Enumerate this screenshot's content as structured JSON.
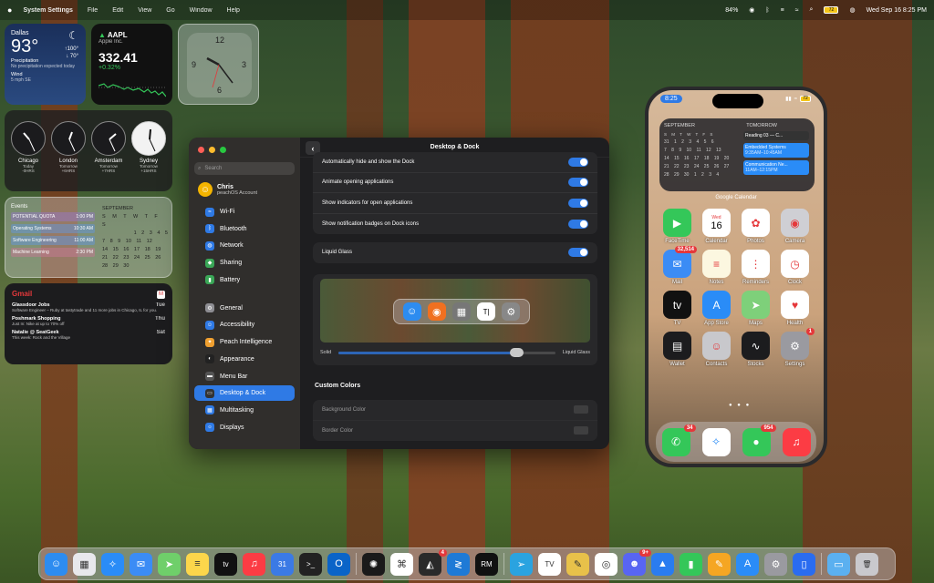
{
  "menubar": {
    "app": "System Settings",
    "items": [
      "File",
      "Edit",
      "View",
      "Go",
      "Window",
      "Help"
    ],
    "battery": "72",
    "datetime": "Wed Sep 16  8:25 PM",
    "percent": "84%"
  },
  "weather": {
    "city": "Dallas",
    "temp": "93°",
    "high": "↑100°",
    "low": "↓ 70°",
    "line1": "Precipitation",
    "line2": "No precipitation expected today",
    "line3": "Wind",
    "line4": "5 mph SE"
  },
  "stock": {
    "ticker": "AAPL",
    "company": "Apple Inc.",
    "price": "332.41",
    "change": "+0.32%"
  },
  "analog": {
    "n12": "12",
    "n3": "3",
    "n6": "6",
    "n9": "9"
  },
  "worldclocks": [
    {
      "city": "Chicago",
      "day": "Today",
      "off": "-0HRS"
    },
    {
      "city": "London",
      "day": "Tomorrow",
      "off": "+6HRS"
    },
    {
      "city": "Amsterdam",
      "day": "Tomorrow",
      "off": "+7HRS"
    },
    {
      "city": "Sydney",
      "day": "Tomorrow",
      "off": "+15HRS"
    }
  ],
  "events": {
    "title": "Events",
    "list": [
      {
        "name": "POTENTIAL QUOTA",
        "time": "1:00 PM"
      },
      {
        "name": "Operating Systems",
        "time": "10:30 AM"
      },
      {
        "name": "Software Engineering",
        "time": "11:00 AM"
      },
      {
        "name": "Machine Learning",
        "time": "2:30 PM"
      }
    ],
    "month": "SEPTEMBER",
    "days": "S M T W T F S",
    "weeks": [
      "1 2 3 4 5",
      "7 8 9 10 11 12",
      "14 15 16 17 18 19",
      "21 22 23 24 25 26",
      "28 29 30"
    ]
  },
  "gmail": {
    "title": "Gmail",
    "mails": [
      {
        "from": "Glassdoor Jobs",
        "date": "Tue",
        "body": "Software Engineer – Ruby at tastytrade and 11 more jobs in Chicago, IL for you."
      },
      {
        "from": "Poshmark Shopping",
        "date": "Thu",
        "body": "Just In: Nike at up to 70% off"
      },
      {
        "from": "Natalie @ SeatGeek",
        "date": "Sat",
        "body": "This week: Rock and the Village"
      }
    ]
  },
  "settings": {
    "title": "Desktop & Dock",
    "search": "Search",
    "user": "Chris",
    "account": "peachOS Account",
    "sidebar": [
      {
        "label": "Wi-Fi",
        "color": "#2f7ae5",
        "icon": "wifi-icon",
        "glyph": "≈"
      },
      {
        "label": "Bluetooth",
        "color": "#2f7ae5",
        "icon": "bluetooth-icon",
        "glyph": "ᛒ"
      },
      {
        "label": "Network",
        "color": "#2f7ae5",
        "icon": "globe-icon",
        "glyph": "◍"
      },
      {
        "label": "Sharing",
        "color": "#3aa757",
        "icon": "sharing-icon",
        "glyph": "◆"
      },
      {
        "label": "Battery",
        "color": "#3aa757",
        "icon": "battery-icon",
        "glyph": "▮"
      },
      {
        "label": "General",
        "color": "#8e8e93",
        "icon": "gear-icon",
        "glyph": "⚙"
      },
      {
        "label": "Accessibility",
        "color": "#2f7ae5",
        "icon": "accessibility-icon",
        "glyph": "☺"
      },
      {
        "label": "Peach Intelligence",
        "color": "#f0a030",
        "icon": "sparkle-icon",
        "glyph": "✦"
      },
      {
        "label": "Appearance",
        "color": "#222",
        "icon": "appearance-icon",
        "glyph": "◐"
      },
      {
        "label": "Menu Bar",
        "color": "#555",
        "icon": "menubar-icon",
        "glyph": "▬"
      },
      {
        "label": "Desktop & Dock",
        "color": "#333",
        "icon": "dock-icon",
        "glyph": "▭"
      },
      {
        "label": "Multitasking",
        "color": "#2f7ae5",
        "icon": "multitasking-icon",
        "glyph": "▦"
      },
      {
        "label": "Displays",
        "color": "#2f7ae5",
        "icon": "display-icon",
        "glyph": "☼"
      }
    ],
    "rows": [
      "Automatically hide and show the Dock",
      "Animate opening applications",
      "Show indicators for open applications",
      "Show notification badges on Dock icons"
    ],
    "liquid": "Liquid Glass",
    "solid": "Solid",
    "liquid_end": "Liquid Glass",
    "slider": 0.82,
    "custom": "Custom Colors",
    "bg": "Background Color",
    "border": "Border Color"
  },
  "phone": {
    "time": "8:25",
    "battery": "72",
    "cal": {
      "month": "SEPTEMBER",
      "tomorrow": "TOMORROW",
      "days": "S M T W T F S",
      "weeks": [
        "31 1 2 3 4 5 6",
        "7 8 9 10 11 12 13",
        "14 15 16 17 18 19 20",
        "21 22 23 24 25 26 27",
        "28 29 30 1 2 3 4"
      ],
      "ev1": "Reading 03 — C...",
      "ev2": "Embedded Systems",
      "ev2t": "9:35AM–10:45AM",
      "ev3": "Communication Ne...",
      "ev3t": "11AM–12:15PM",
      "label": "Google Calendar"
    },
    "apps": [
      {
        "label": "FaceTime",
        "color": "#34c759",
        "glyph": "▶"
      },
      {
        "label": "Calendar",
        "color": "#ffffff",
        "glyph": "16",
        "day": "Wed"
      },
      {
        "label": "Photos",
        "color": "#ffffff",
        "glyph": "✿"
      },
      {
        "label": "Camera",
        "color": "#cfcfd4",
        "glyph": "◉"
      },
      {
        "label": "Mail",
        "color": "#3b8cf5",
        "glyph": "✉",
        "badge": "32,514"
      },
      {
        "label": "Notes",
        "color": "#fcf7e0",
        "glyph": "≡"
      },
      {
        "label": "Reminders",
        "color": "#ffffff",
        "glyph": "⋮"
      },
      {
        "label": "Clock",
        "color": "#ffffff",
        "glyph": "◷"
      },
      {
        "label": "TV",
        "color": "#111111",
        "glyph": "tv"
      },
      {
        "label": "App Store",
        "color": "#2a8cf7",
        "glyph": "A"
      },
      {
        "label": "Maps",
        "color": "#7ed07a",
        "glyph": "➤"
      },
      {
        "label": "Health",
        "color": "#ffffff",
        "glyph": "♥"
      },
      {
        "label": "Wallet",
        "color": "#1c1c1e",
        "glyph": "▤"
      },
      {
        "label": "Contacts",
        "color": "#c8c8cc",
        "glyph": "☺"
      },
      {
        "label": "Stocks",
        "color": "#1c1c1e",
        "glyph": "∿"
      },
      {
        "label": "Settings",
        "color": "#9a9aa0",
        "glyph": "⚙",
        "badge": "1"
      }
    ],
    "dock": [
      {
        "label": "Phone",
        "color": "#34c759",
        "glyph": "✆",
        "badge": "34"
      },
      {
        "label": "Safari",
        "color": "#ffffff",
        "glyph": "✧"
      },
      {
        "label": "Messages",
        "color": "#34c759",
        "glyph": "●",
        "badge": "954"
      },
      {
        "label": "Music",
        "color": "#fc3c44",
        "glyph": "♫"
      }
    ]
  },
  "dock": [
    {
      "n": "finder-icon",
      "c": "#2d8cf0",
      "g": "☺"
    },
    {
      "n": "launchpad-icon",
      "c": "#e8e8ec",
      "g": "▦"
    },
    {
      "n": "safari-icon",
      "c": "#2a8cf7",
      "g": "✧"
    },
    {
      "n": "mail-icon",
      "c": "#3b8cf5",
      "g": "✉"
    },
    {
      "n": "maps-icon",
      "c": "#6fcf6a",
      "g": "➤"
    },
    {
      "n": "notes-icon",
      "c": "#fcd64b",
      "g": "≡"
    },
    {
      "n": "tv-icon",
      "c": "#111",
      "g": "tv"
    },
    {
      "n": "music-icon",
      "c": "#fc3c44",
      "g": "♫"
    },
    {
      "n": "calendar-icon",
      "c": "#3b7ae5",
      "g": "31"
    },
    {
      "n": "terminal-icon",
      "c": "#222",
      "g": ">_"
    },
    {
      "n": "outlook-icon",
      "c": "#0a64c8",
      "g": "O"
    },
    {
      "sep": true
    },
    {
      "n": "spark-icon",
      "c": "#1a1a1a",
      "g": "✺"
    },
    {
      "n": "chatgpt-icon",
      "c": "#ffffff",
      "g": "⌘"
    },
    {
      "n": "cursor-icon",
      "c": "#2a2a2a",
      "g": "◭",
      "badge": "4"
    },
    {
      "n": "vscode-icon",
      "c": "#1e7ad6",
      "g": "≷"
    },
    {
      "n": "rubymine-icon",
      "c": "#111",
      "g": "RM"
    },
    {
      "sep": true
    },
    {
      "n": "telegram-icon",
      "c": "#2aa3e0",
      "g": "➢"
    },
    {
      "n": "tradingview-icon",
      "c": "#ffffff",
      "g": "TV"
    },
    {
      "n": "notchmeister-icon",
      "c": "#e8c14a",
      "g": "✎"
    },
    {
      "n": "chrome-icon",
      "c": "#ffffff",
      "g": "◎"
    },
    {
      "n": "discord-icon",
      "c": "#5865f2",
      "g": "☻",
      "badge": "9+"
    },
    {
      "n": "keynote-icon",
      "c": "#2a7cf0",
      "g": "▲"
    },
    {
      "n": "numbers-icon",
      "c": "#34c759",
      "g": "▮"
    },
    {
      "n": "pages-icon",
      "c": "#f5a623",
      "g": "✎"
    },
    {
      "n": "appstore-icon",
      "c": "#2a8cf7",
      "g": "A"
    },
    {
      "n": "settings-icon",
      "c": "#9a9aa0",
      "g": "⚙"
    },
    {
      "n": "iphone-mirroring-icon",
      "c": "#2a6cf0",
      "g": "▯"
    },
    {
      "sep": true
    },
    {
      "n": "downloads-folder-icon",
      "c": "#5bb0f0",
      "g": "▭"
    },
    {
      "n": "trash-icon",
      "c": "#c9c9cd",
      "g": "🗑"
    }
  ]
}
